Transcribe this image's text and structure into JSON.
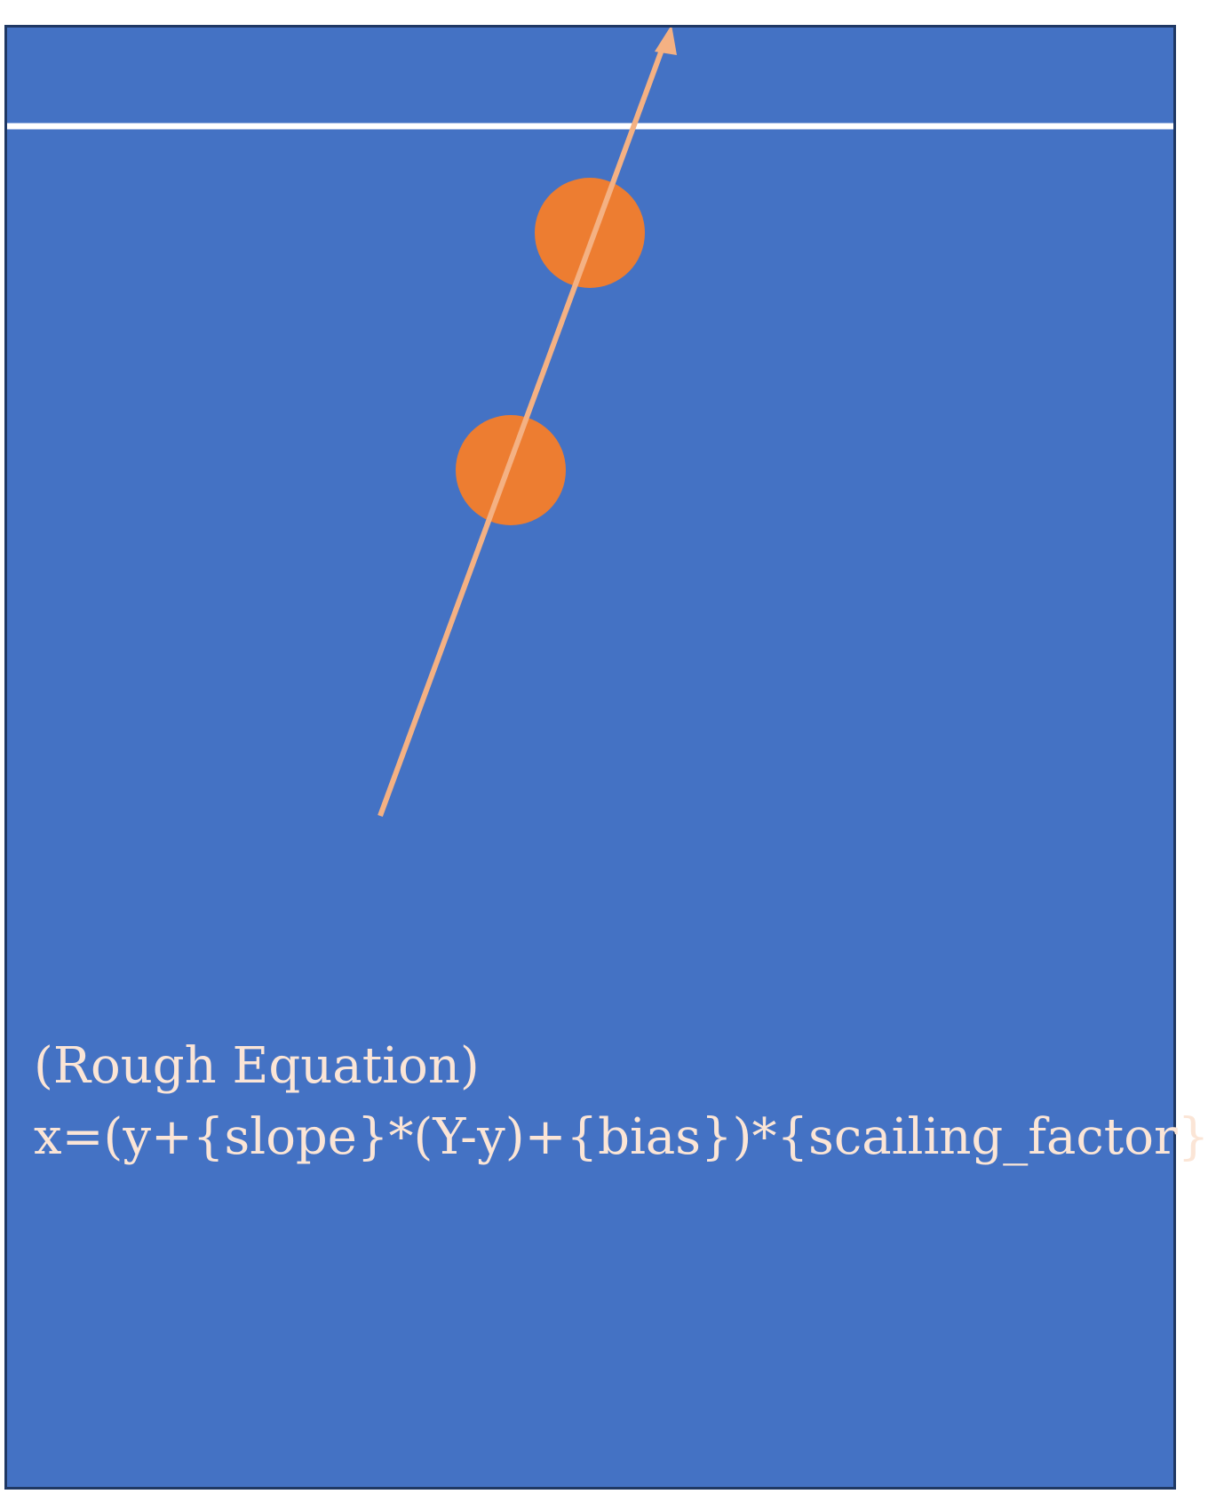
{
  "colors": {
    "background": "#4472c4",
    "border": "#1f3864",
    "line": "#ffffff",
    "ball": "#ed7d31",
    "arrow": "#f4b183",
    "text": "#fbe5d6"
  },
  "equation": {
    "heading": "(Rough Equation)",
    "formula": "x=(y+{slope}*(Y-y)+{bias})*{scailing_factor}"
  }
}
